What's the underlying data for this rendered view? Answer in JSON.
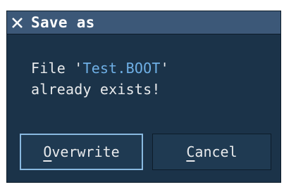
{
  "dialog": {
    "title": "Save as",
    "message": {
      "prefix": "File '",
      "filename": "Test.BOOT",
      "suffix": "'",
      "line2": "already exists!"
    },
    "buttons": {
      "overwrite": {
        "accel": "O",
        "rest": "verwrite"
      },
      "cancel": {
        "accel": "C",
        "rest": "ancel"
      }
    }
  },
  "colors": {
    "dialog_bg": "#1b3349",
    "titlebar_bg": "#3c5878",
    "filename_accent": "#6fb0e6",
    "focus_border": "#89b9e0"
  },
  "icons": {
    "close": "close-icon"
  }
}
